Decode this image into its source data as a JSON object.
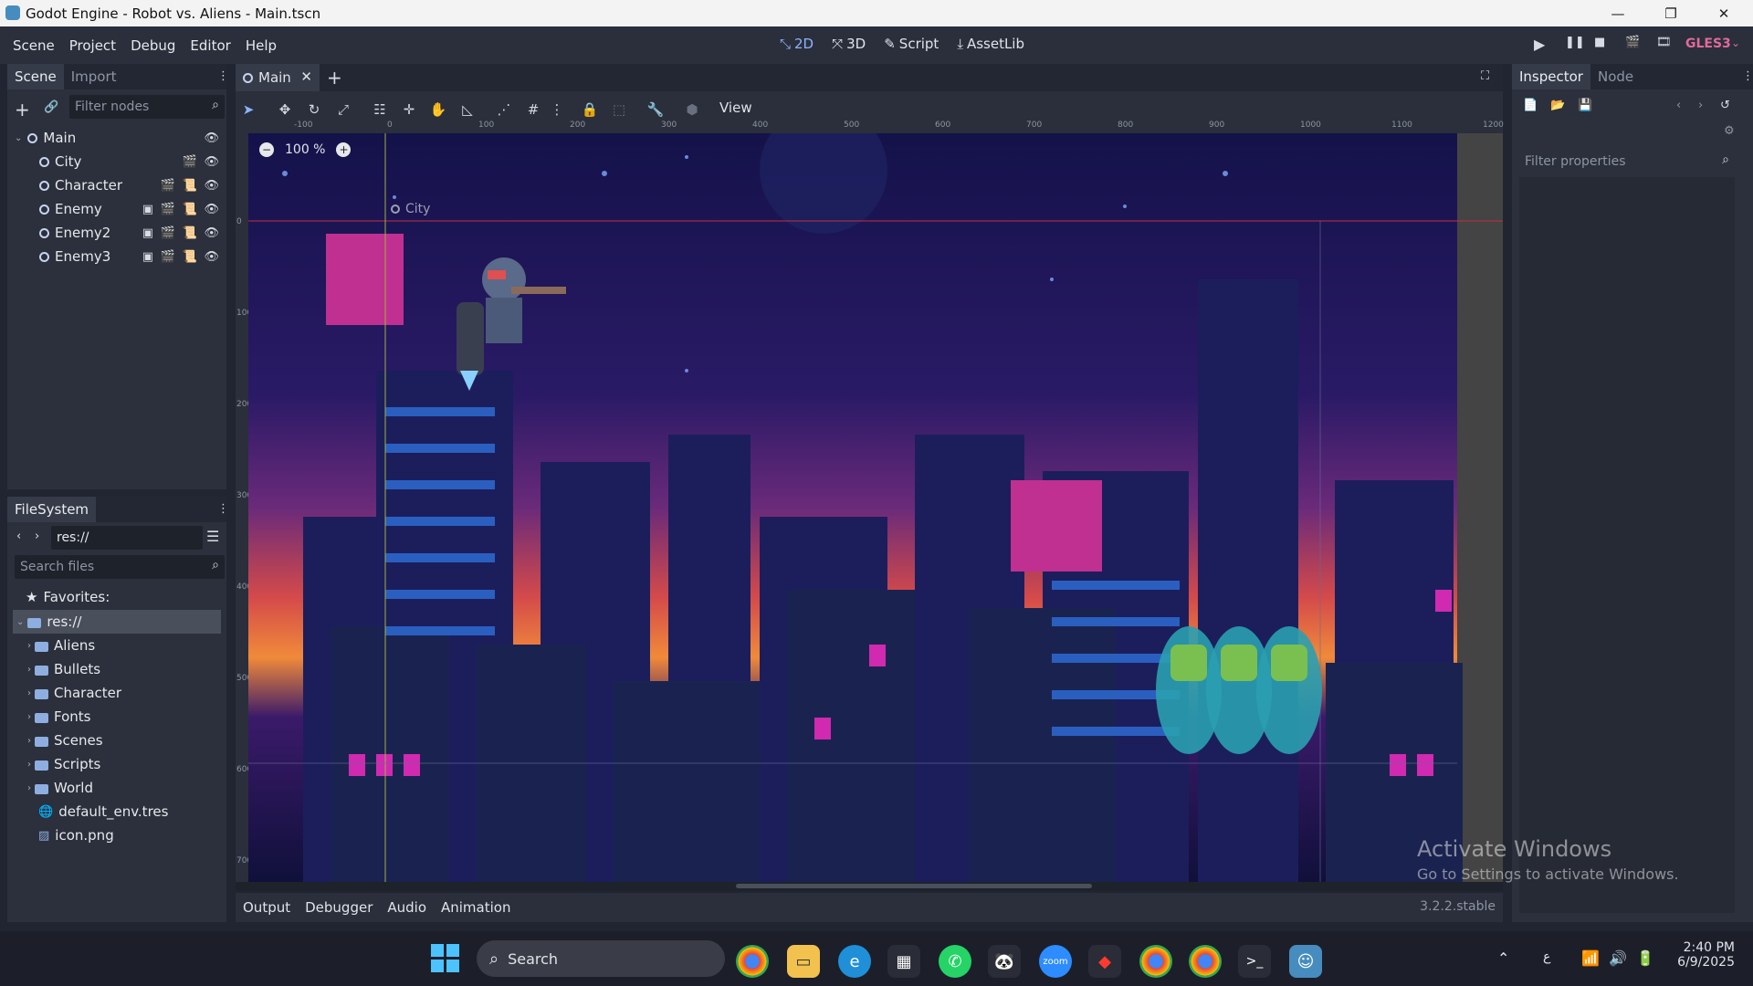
{
  "window": {
    "title": "Godot Engine - Robot vs. Aliens - Main.tscn",
    "minimize": "—",
    "maximize": "❐",
    "close": "✕"
  },
  "menu": [
    "Scene",
    "Project",
    "Debug",
    "Editor",
    "Help"
  ],
  "main_screens": {
    "2d": "2D",
    "3d": "3D",
    "script": "Script",
    "assetlib": "AssetLib"
  },
  "renderer": "GLES3",
  "scene_dock": {
    "tabs": [
      "Scene",
      "Import"
    ],
    "filter_placeholder": "Filter nodes",
    "nodes": [
      "Main",
      "City",
      "Character",
      "Enemy",
      "Enemy2",
      "Enemy3"
    ]
  },
  "filesystem": {
    "title": "FileSystem",
    "path": "res://",
    "search_placeholder": "Search files",
    "favorites": "Favorites:",
    "root": "res://",
    "items": [
      "Aliens",
      "Bullets",
      "Character",
      "Fonts",
      "Scenes",
      "Scripts",
      "World",
      "default_env.tres",
      "icon.png"
    ]
  },
  "editor": {
    "scene_tab": "Main",
    "view_menu": "View",
    "zoom": "100 %",
    "node_label": "City",
    "ruler_labels": [
      "-100",
      "0",
      "100",
      "200",
      "300",
      "400",
      "500",
      "600",
      "700",
      "800",
      "900",
      "1000",
      "1100",
      "1200"
    ],
    "vruler_labels": [
      "0",
      "100",
      "200",
      "300",
      "400",
      "500",
      "600",
      "700"
    ]
  },
  "bottom_panel": {
    "tabs": [
      "Output",
      "Debugger",
      "Audio",
      "Animation"
    ],
    "version": "3.2.2.stable"
  },
  "inspector": {
    "tabs": [
      "Inspector",
      "Node"
    ],
    "filter_placeholder": "Filter properties"
  },
  "watermark": {
    "line1": "Activate Windows",
    "line2": "Go to Settings to activate Windows."
  },
  "taskbar": {
    "search": "Search",
    "time": "2:40 PM",
    "date": "6/9/2025",
    "lang": "ع"
  },
  "colors": {
    "accent": "#8ab4ff",
    "renderer": "#e06a9a",
    "panel": "#2b303c",
    "bg": "#202531"
  }
}
